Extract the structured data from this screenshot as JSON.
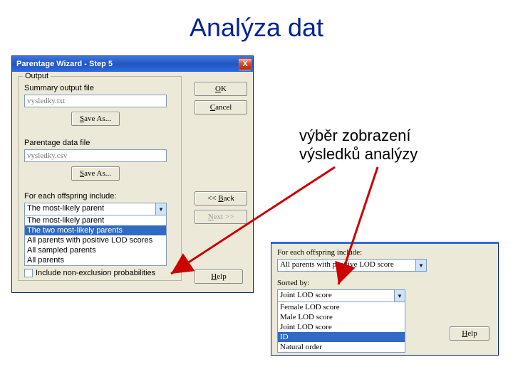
{
  "slide": {
    "title": "Analýza dat",
    "annotation_l1": "výběr zobrazení",
    "annotation_l2": "výsledků analýzy"
  },
  "dialog": {
    "title": "Parentage Wizard - Step 5",
    "close": "X",
    "group_output": "Output",
    "summary_label": "Summary output file",
    "summary_value": "vysledky.txt",
    "parentage_label": "Parentage data file",
    "parentage_value": "vysledky.csv",
    "saveas": "Save As...",
    "for_each": "For each offspring include:",
    "combo_value": "The most-likely parent",
    "list": {
      "i0": "The most-likely parent",
      "i1": "The two most-likely parents",
      "i2": "All parents with positive LOD scores",
      "i3": "All sampled parents",
      "i4": "All parents"
    },
    "checkbox": "Include non-exclusion probabilities",
    "buttons": {
      "ok": "OK",
      "cancel": "Cancel",
      "back": "<< Back",
      "next": "Next >>",
      "help": "Help"
    },
    "u": {
      "ok": "O",
      "cancel": "C",
      "save": "S",
      "back": "B",
      "next": "N",
      "help": "H"
    }
  },
  "frag2": {
    "for_each": "For each offspring include:",
    "combo_value": "All parents with positive LOD score",
    "sorted_by": "Sorted by:",
    "combo2_value": "Joint LOD score",
    "list": {
      "i0": "Female LOD score",
      "i1": "Male LOD score",
      "i2": "Joint LOD score",
      "i3": "ID",
      "i4": "Natural order"
    },
    "help": "Help"
  }
}
